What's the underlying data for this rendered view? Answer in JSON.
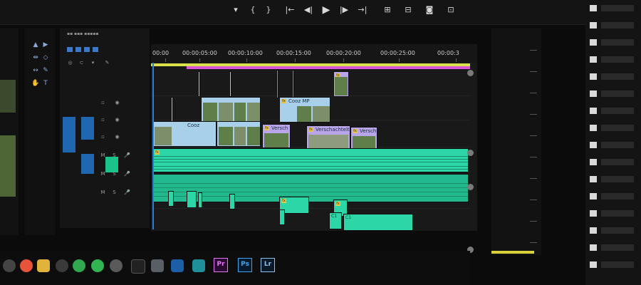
{
  "colors": {
    "playhead": "#2b7fd8",
    "work_area": "#d8e04a",
    "render_bar": "#d957d6",
    "video_clip": "#a9d0ea",
    "audio_clip": "#2cd6a6",
    "premiere_accent": "#e476f4",
    "photoshop_accent": "#3aa7f5",
    "lightroom_accent": "#8fc0ec"
  },
  "timeline": {
    "timecodes": [
      "00:00",
      "00:00:05:00",
      "00:00:10:00",
      "00:00:15:00",
      "00:00:20:00",
      "00:00:25:00",
      "00:00:3"
    ],
    "video_clips": [
      {
        "label": "Cooz",
        "icon": "fx-badge"
      },
      {
        "label": "Cooz MP",
        "icon": "fx-badge"
      },
      {
        "label": "Versch",
        "icon": "fx-badge"
      },
      {
        "label": "Verschachtelt",
        "icon": "fx-badge"
      },
      {
        "label": "Versch",
        "icon": "fx-badge"
      }
    ],
    "audio_labels": [
      "C1",
      "C1"
    ]
  },
  "taskbar": {
    "apps": [
      {
        "label": "Pr",
        "icon": "premiere-icon"
      },
      {
        "label": "Ps",
        "icon": "photoshop-icon"
      },
      {
        "label": "Lr",
        "icon": "lightroom-icon"
      }
    ]
  }
}
